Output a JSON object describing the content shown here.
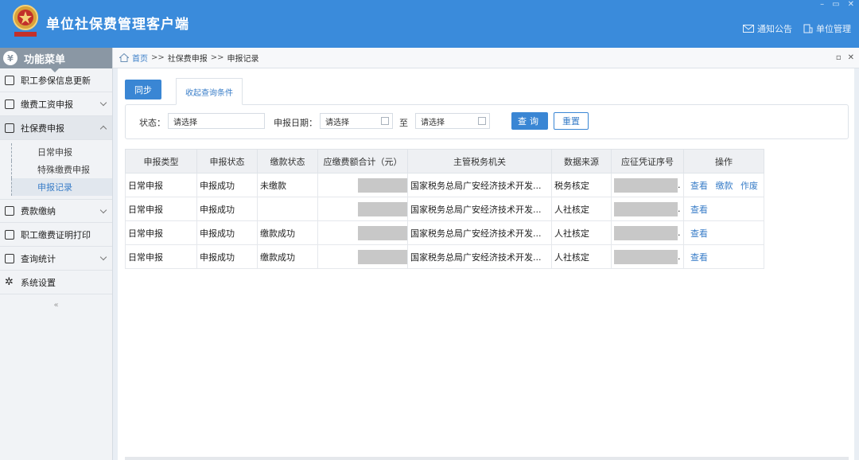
{
  "header": {
    "app_title": "单位社保费管理客户端",
    "notice_label": "通知公告",
    "unit_label": "单位管理"
  },
  "sidebar": {
    "menu_title": "功能菜单",
    "items": [
      {
        "label": "职工参保信息更新",
        "icon": "document-list-icon"
      },
      {
        "label": "缴费工资申报",
        "icon": "edit-icon"
      },
      {
        "label": "社保费申报",
        "icon": "form-icon"
      }
    ],
    "sub_items": [
      "日常申报",
      "特殊缴费申报",
      "申报记录"
    ],
    "items_after": [
      {
        "label": "费款缴纳",
        "icon": "wallet-icon"
      },
      {
        "label": "职工缴费证明打印",
        "icon": "printer-icon"
      },
      {
        "label": "查询统计",
        "icon": "chart-icon"
      },
      {
        "label": "系统设置",
        "icon": "gear-icon"
      }
    ],
    "collapse_symbol": "«"
  },
  "breadcrumb": {
    "home": "首页",
    "sep": ">>",
    "level1": "社保费申报",
    "level2": "申报记录"
  },
  "toolbar": {
    "sync_label": "同步",
    "tab_label": "收起查询条件"
  },
  "filters": {
    "status_label": "状态：",
    "status_value": "请选择",
    "date_label": "申报日期：",
    "date_from": "请选择",
    "date_to_label": "至",
    "date_to": "请选择",
    "query_label": "查询",
    "reset_label": "重置"
  },
  "table": {
    "columns": [
      "申报类型",
      "申报状态",
      "缴款状态",
      "应缴费额合计（元）",
      "主管税务机关",
      "数据来源",
      "应征凭证序号",
      "操作"
    ],
    "rows": [
      {
        "type": "日常申报",
        "status": "申报成功",
        "pay_status": "未缴款",
        "org": "国家税务总局广安经济技术开发...",
        "source": "税务核定",
        "ops": [
          "查看",
          "缴款",
          "作废"
        ]
      },
      {
        "type": "日常申报",
        "status": "申报成功",
        "pay_status": "",
        "org": "国家税务总局广安经济技术开发...",
        "source": "人社核定",
        "ops": [
          "查看"
        ]
      },
      {
        "type": "日常申报",
        "status": "申报成功",
        "pay_status": "缴款成功",
        "org": "国家税务总局广安经济技术开发...",
        "source": "人社核定",
        "ops": [
          "查看"
        ]
      },
      {
        "type": "日常申报",
        "status": "申报成功",
        "pay_status": "缴款成功",
        "org": "国家税务总局广安经济技术开发...",
        "source": "人社核定",
        "ops": [
          "查看"
        ]
      }
    ],
    "trunc_mark": "."
  },
  "colors": {
    "header_bg": "#3a8bdb",
    "accent": "#3a86d4",
    "link": "#3a7ec8"
  }
}
